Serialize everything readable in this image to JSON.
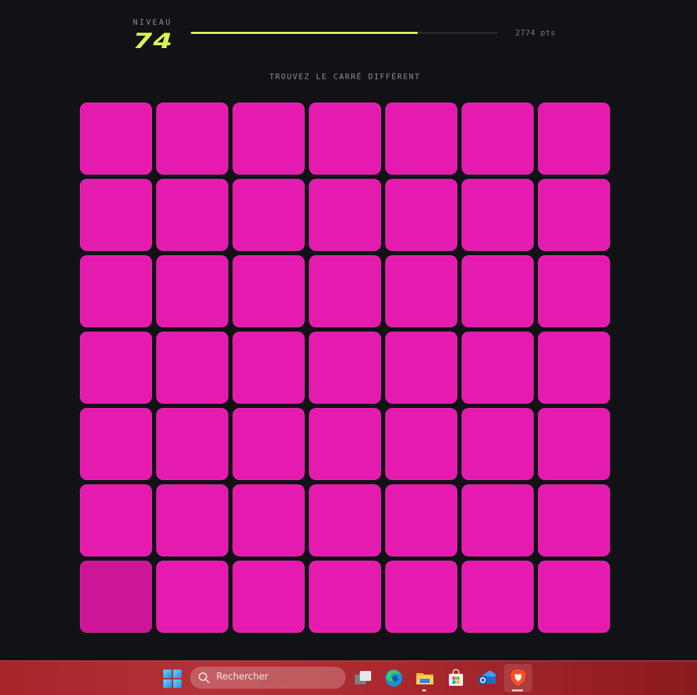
{
  "game": {
    "level_label": "NIVEAU",
    "level": "74",
    "progress": 0.74,
    "score": "2774 pts",
    "instruction": "TROUVEZ LE CARRÉ DIFFÉRENT",
    "grid_size": 7,
    "base_color": "#e51aae",
    "odd_color": "#cc1597",
    "odd_index": 42,
    "accent_color": "#dcf453"
  },
  "taskbar": {
    "search_placeholder": "Rechercher",
    "icons": [
      "windows-start-icon",
      "search-icon",
      "task-view-icon",
      "edge-icon",
      "file-explorer-icon",
      "microsoft-store-icon",
      "outlook-icon",
      "brave-icon"
    ]
  }
}
